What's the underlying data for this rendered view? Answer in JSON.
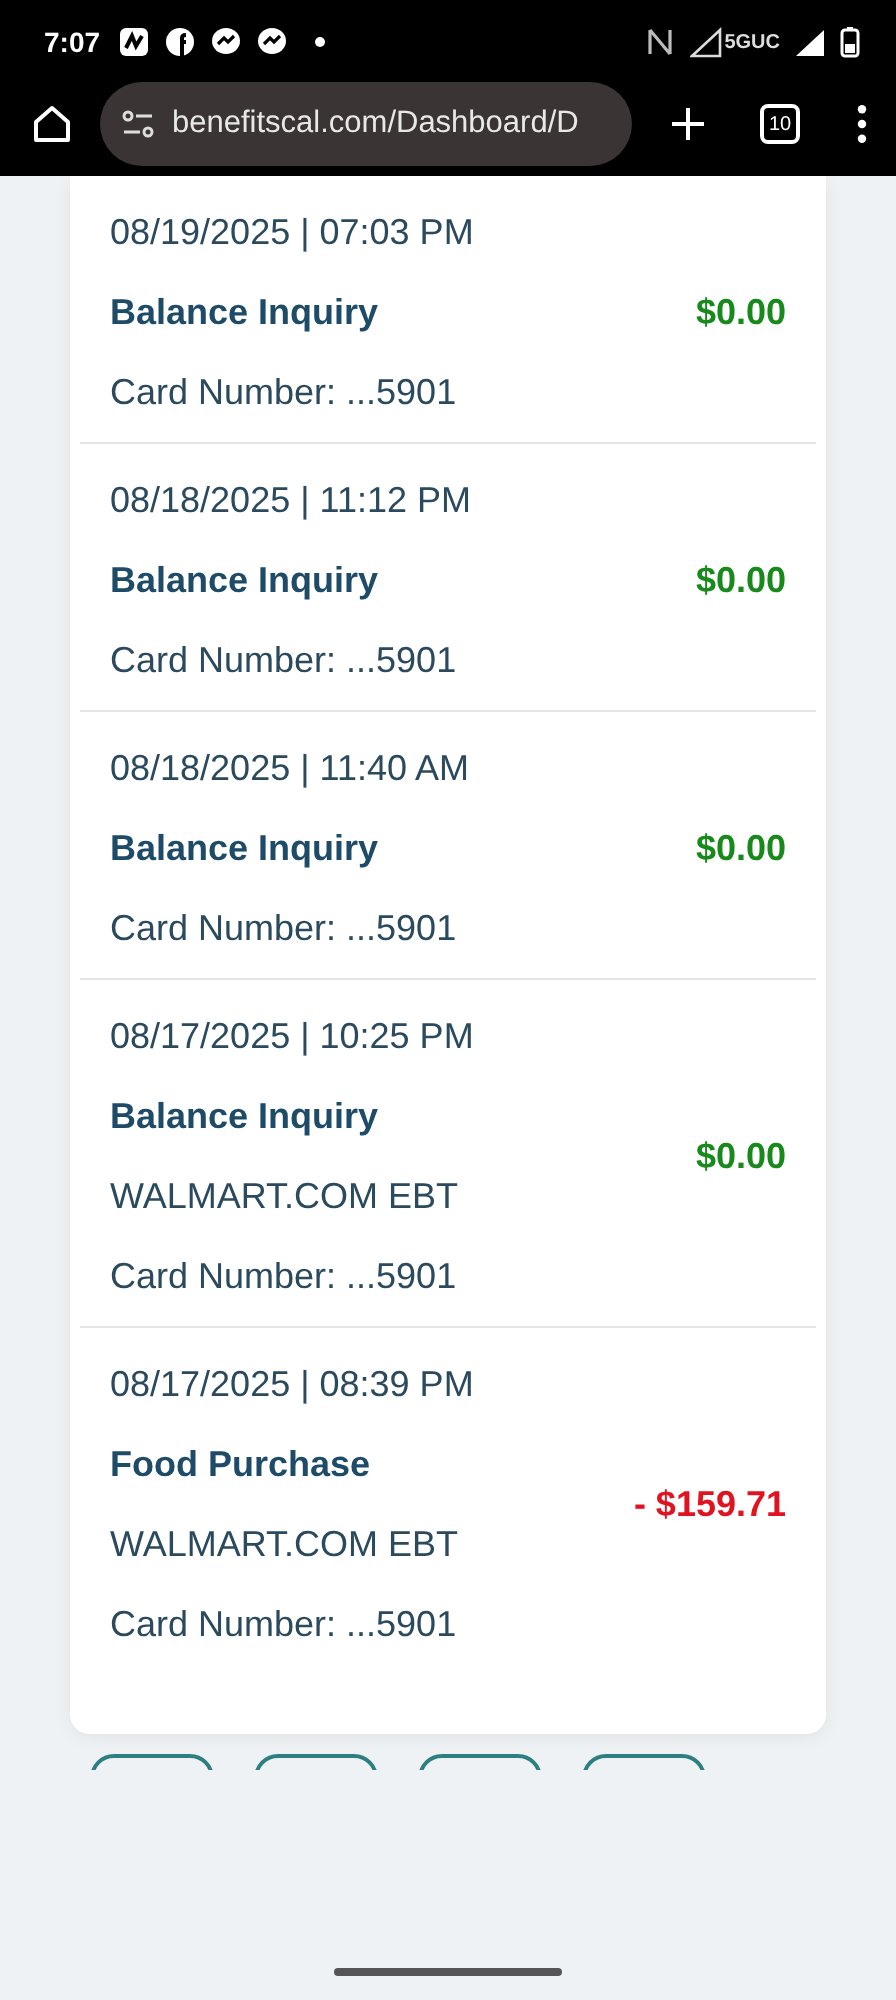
{
  "status_bar": {
    "time": "7:07",
    "network": "5GUC"
  },
  "browser": {
    "url": "benefitscal.com/Dashboard/D",
    "tab_count": "10"
  },
  "transactions": [
    {
      "date": "08/19/2025 | 07:03 PM",
      "type": "Balance Inquiry",
      "amount": "$0.00",
      "kind": "credit",
      "card": "Card Number: ...5901"
    },
    {
      "date": "08/18/2025 | 11:12 PM",
      "type": "Balance Inquiry",
      "amount": "$0.00",
      "kind": "credit",
      "card": "Card Number: ...5901"
    },
    {
      "date": "08/18/2025 | 11:40 AM",
      "type": "Balance Inquiry",
      "amount": "$0.00",
      "kind": "credit",
      "card": "Card Number: ...5901"
    },
    {
      "date": "08/17/2025 | 10:25 PM",
      "type": "Balance Inquiry",
      "merchant": "WALMART.COM EBT",
      "amount": "$0.00",
      "kind": "credit",
      "card": "Card Number: ...5901"
    },
    {
      "date": "08/17/2025 | 08:39 PM",
      "type": "Food Purchase",
      "merchant": "WALMART.COM EBT",
      "amount": "- $159.71",
      "kind": "debit",
      "card": "Card Number: ...5901"
    }
  ]
}
